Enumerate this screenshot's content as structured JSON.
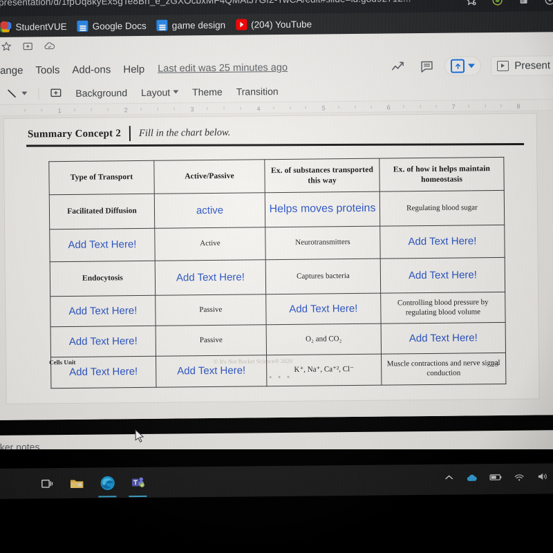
{
  "browser": {
    "url": "presentation/d/1fpUq8kyEx5gTe8Bh_e_zGXOcbxMF4QMAtJ7Gf2-TwCA/edit#slide=id.g8d92712...",
    "tab_icons": [
      "bookmark-star-icon",
      "extension-puzzle-icon",
      "profile-icon",
      "menu-icon"
    ],
    "bookmarks": [
      {
        "label": "StudentVUE",
        "icon": "studentvue-icon"
      },
      {
        "label": "Google Docs",
        "icon": "google-docs-icon"
      },
      {
        "label": "game design",
        "icon": "google-docs-icon"
      },
      {
        "label": "(204) YouTube",
        "icon": "youtube-icon"
      }
    ]
  },
  "slides_app": {
    "quick_icons": [
      "star-icon",
      "move-to-folder-icon",
      "cloud-saved-icon"
    ],
    "menus": [
      "ange",
      "Tools",
      "Add-ons",
      "Help"
    ],
    "last_edit": "Last edit was 25 minutes ago",
    "right_actions": {
      "trend_icon": "activity-dashboard-icon",
      "comment_icon": "comment-history-icon",
      "share_label": "",
      "present_label": "Present"
    },
    "toolbar2": {
      "line_tool": "line-tool",
      "comment_tool": "add-comment-tool",
      "buttons": [
        "Background",
        "Layout",
        "Theme",
        "Transition"
      ]
    },
    "ruler_marks": [
      "1",
      "2",
      "3",
      "4",
      "5",
      "6",
      "7",
      "8"
    ],
    "speaker_notes_label": "eaker notes"
  },
  "slide": {
    "title": "Summary Concept 2",
    "subtitle": "Fill in the chart below.",
    "footer_left": "Cells Unit",
    "footer_center": "© It's Not Rocket Science® 2020",
    "page_number": "23",
    "dots": "• • •"
  },
  "table": {
    "headers": [
      "Type of Transport",
      "Active/Passive",
      "Ex. of substances transported this way",
      "Ex. of how it helps maintain homeostasis"
    ],
    "placeholder": "Add Text Here!",
    "rows": [
      {
        "cells": [
          {
            "text": "Facilitated Diffusion",
            "style": "given-bold"
          },
          {
            "text": "active",
            "style": "filled"
          },
          {
            "text": "Helps moves proteins",
            "style": "filled"
          },
          {
            "text": "Regulating blood sugar",
            "style": "given"
          }
        ]
      },
      {
        "cells": [
          {
            "text": "Add Text Here!",
            "style": "blank"
          },
          {
            "text": "Active",
            "style": "given"
          },
          {
            "text": "Neurotransmitters",
            "style": "given"
          },
          {
            "text": "Add Text Here!",
            "style": "blank"
          }
        ]
      },
      {
        "cells": [
          {
            "text": "Endocytosis",
            "style": "given-bold"
          },
          {
            "text": "Add Text Here!",
            "style": "blank"
          },
          {
            "text": "Captures bacteria",
            "style": "given"
          },
          {
            "text": "Add Text Here!",
            "style": "blank"
          }
        ]
      },
      {
        "cells": [
          {
            "text": "Add Text Here!",
            "style": "blank"
          },
          {
            "text": "Passive",
            "style": "given"
          },
          {
            "text": "Add Text Here!",
            "style": "blank"
          },
          {
            "text": "Controlling blood pressure by regulating blood volume",
            "style": "given"
          }
        ]
      },
      {
        "cells": [
          {
            "text": "Add Text Here!",
            "style": "blank"
          },
          {
            "text": "Passive",
            "style": "given"
          },
          {
            "text": "O₂ and CO₂",
            "style": "given"
          },
          {
            "text": "Add Text Here!",
            "style": "blank"
          }
        ]
      },
      {
        "cells": [
          {
            "text": "Add Text Here!",
            "style": "blank"
          },
          {
            "text": "Add Text Here!",
            "style": "blank"
          },
          {
            "text": "K⁺, Na⁺, Ca⁺², Cl⁻",
            "style": "given"
          },
          {
            "text": "Muscle contractions and nerve signal conduction",
            "style": "given"
          }
        ]
      }
    ]
  },
  "taskbar": {
    "apps": [
      {
        "name": "task-view-icon",
        "active": false
      },
      {
        "name": "file-explorer-icon",
        "active": false
      },
      {
        "name": "microsoft-edge-icon",
        "active": true
      },
      {
        "name": "microsoft-teams-icon",
        "active": true
      }
    ],
    "tray": [
      "show-hidden-icons-chevron",
      "onedrive-icon",
      "battery-icon",
      "wifi-icon",
      "volume-icon"
    ]
  },
  "colors": {
    "blue_text": "#2a55c7",
    "chrome_dark": "#202124",
    "slide_bg": "#f4f2ee",
    "accent_blue": "#1a73e8"
  }
}
